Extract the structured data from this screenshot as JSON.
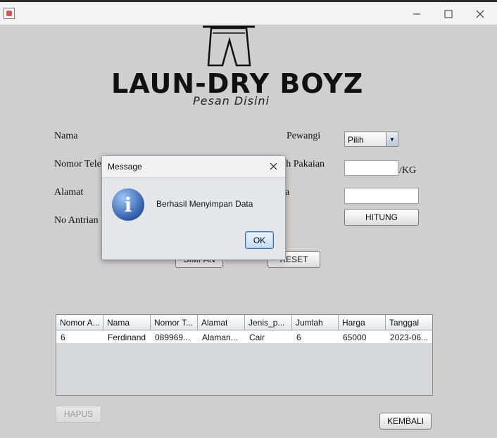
{
  "window": {
    "minimize_icon": "minimize-icon",
    "maximize_icon": "maximize-icon",
    "close_icon": "close-icon"
  },
  "logo": {
    "title": "LAUN-DRY BOYZ",
    "subtitle": "Pesan Disini"
  },
  "form": {
    "labels": {
      "nama": "Nama",
      "nomor_telepon": "Nomor Tele",
      "alamat": "Alamat",
      "no_antrian": "No Antrian",
      "pewangi": "Pewangi",
      "jumlah_pakaian": "ah Pakaian",
      "harga": "a",
      "unit": "/KG"
    },
    "pewangi_selected": "Pilih",
    "jumlah_value": "",
    "harga_value": ""
  },
  "buttons": {
    "hitung": "HITUNG",
    "simpan": "SIMPAN",
    "reset": "RESET",
    "hapus": "HAPUS",
    "kembali": "KEMBALI"
  },
  "table": {
    "columns": [
      "Nomor A...",
      "Nama",
      "Nomor T...",
      "Alamat",
      "Jenis_p...",
      "Jumlah",
      "Harga",
      "Tanggal"
    ],
    "rows": [
      [
        "6",
        "Ferdinand",
        "089969...",
        "Alaman...",
        "Cair",
        "6",
        "65000",
        "2023-06..."
      ]
    ]
  },
  "dialog": {
    "title": "Message",
    "message": "Berhasil Menyimpan Data",
    "ok_label": "OK",
    "icon": "info-icon"
  }
}
